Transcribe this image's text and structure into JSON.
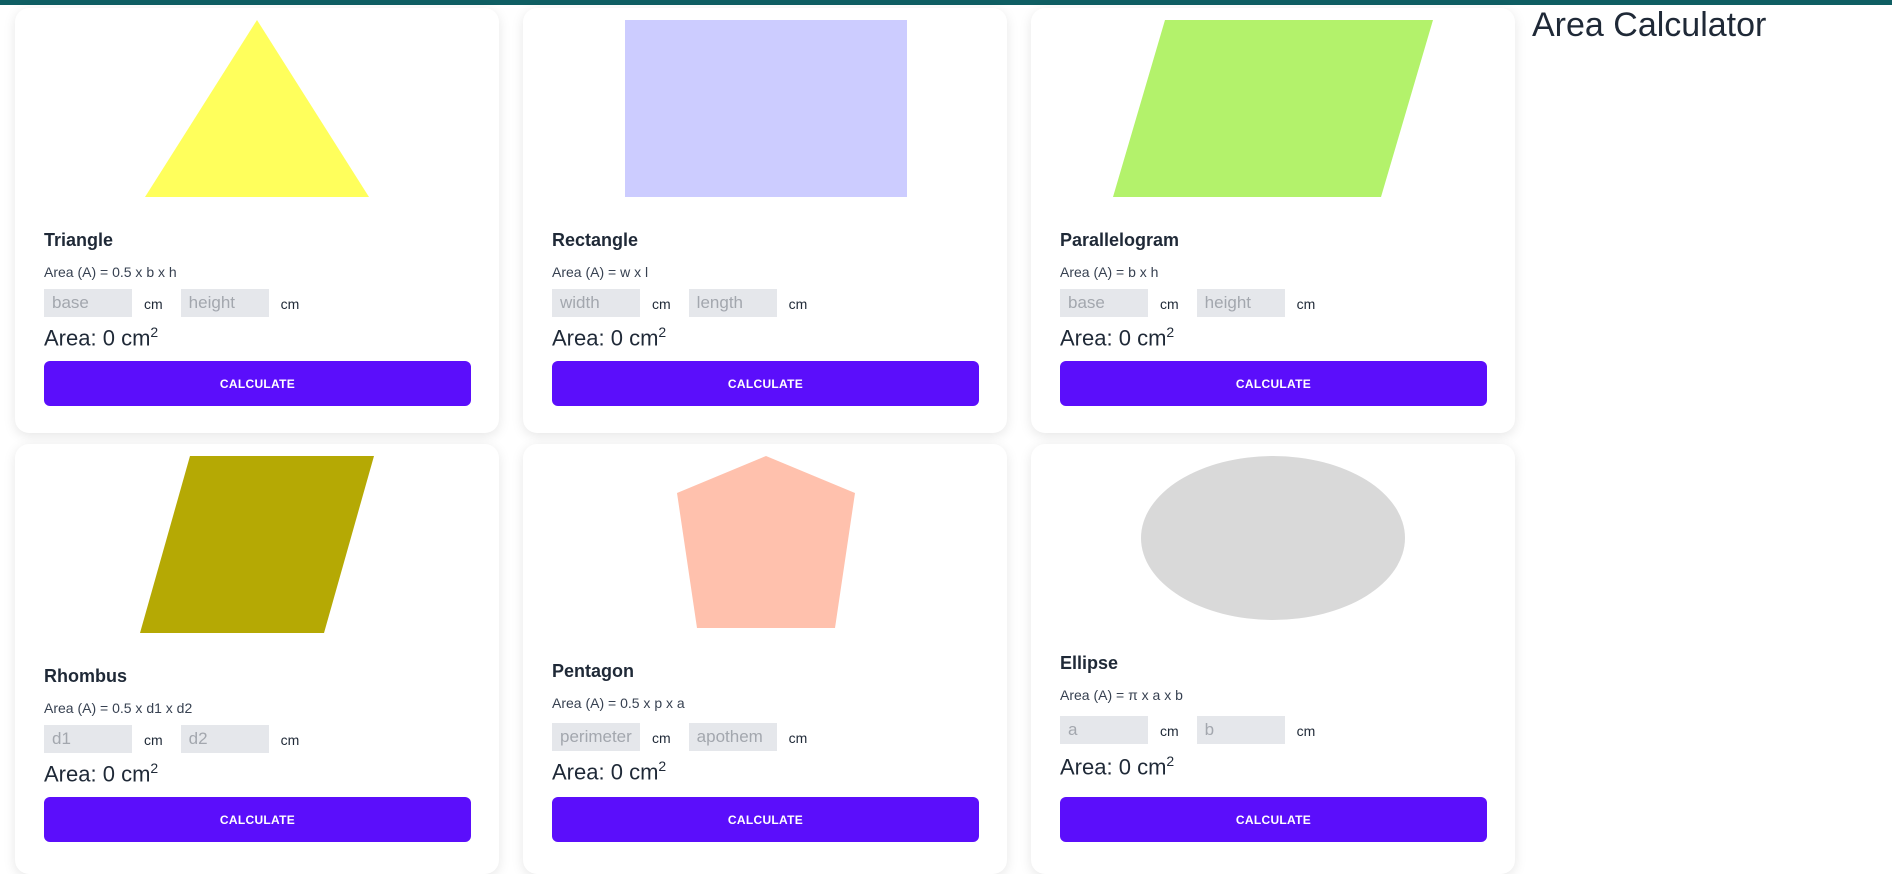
{
  "app": {
    "title": "Area Calculator",
    "accent_color": "#0f5e63"
  },
  "button_color": "#5b0efb",
  "cards": [
    {
      "name": "Triangle",
      "formula": "Area (A) = 0.5 x b x h",
      "input1_placeholder": "base",
      "input2_placeholder": "height",
      "unit1": "cm",
      "unit2": "cm",
      "result_label": "Area: ",
      "result_value": "0",
      "result_unit": "cm",
      "result_exponent": "2",
      "button_label": "CALCULATE",
      "shape_icon": "triangle-icon",
      "shape_color": "#ffff5c"
    },
    {
      "name": "Rectangle",
      "formula": "Area (A) = w x l",
      "input1_placeholder": "width",
      "input2_placeholder": "length",
      "unit1": "cm",
      "unit2": "cm",
      "result_label": "Area: ",
      "result_value": "0",
      "result_unit": "cm",
      "result_exponent": "2",
      "button_label": "CALCULATE",
      "shape_icon": "rectangle-icon",
      "shape_color": "#ccccff"
    },
    {
      "name": "Parallelogram",
      "formula": "Area (A) = b x h",
      "input1_placeholder": "base",
      "input2_placeholder": "height",
      "unit1": "cm",
      "unit2": "cm",
      "result_label": "Area: ",
      "result_value": "0",
      "result_unit": "cm",
      "result_exponent": "2",
      "button_label": "CALCULATE",
      "shape_icon": "parallelogram-icon",
      "shape_color": "#b3f26b"
    },
    {
      "name": "Rhombus",
      "formula": "Area (A) = 0.5 x d1 x d2",
      "input1_placeholder": "d1",
      "input2_placeholder": "d2",
      "unit1": "cm",
      "unit2": "cm",
      "result_label": "Area: ",
      "result_value": "0",
      "result_unit": "cm",
      "result_exponent": "2",
      "button_label": "CALCULATE",
      "shape_icon": "rhombus-icon",
      "shape_color": "#b5a904"
    },
    {
      "name": "Pentagon",
      "formula": "Area (A) = 0.5 x p x a",
      "input1_placeholder": "perimeter",
      "input2_placeholder": "apothem",
      "unit1": "cm",
      "unit2": "cm",
      "result_label": "Area: ",
      "result_value": "0",
      "result_unit": "cm",
      "result_exponent": "2",
      "button_label": "CALCULATE",
      "shape_icon": "pentagon-icon",
      "shape_color": "#ffc1ad"
    },
    {
      "name": "Ellipse",
      "formula": "Area (A) = π x a x b",
      "input1_placeholder": "a",
      "input2_placeholder": "b",
      "unit1": "cm",
      "unit2": "cm",
      "result_label": "Area: ",
      "result_value": "0",
      "result_unit": "cm",
      "result_exponent": "2",
      "button_label": "CALCULATE",
      "shape_icon": "ellipse-icon",
      "shape_color": "#d9d9d9"
    }
  ]
}
